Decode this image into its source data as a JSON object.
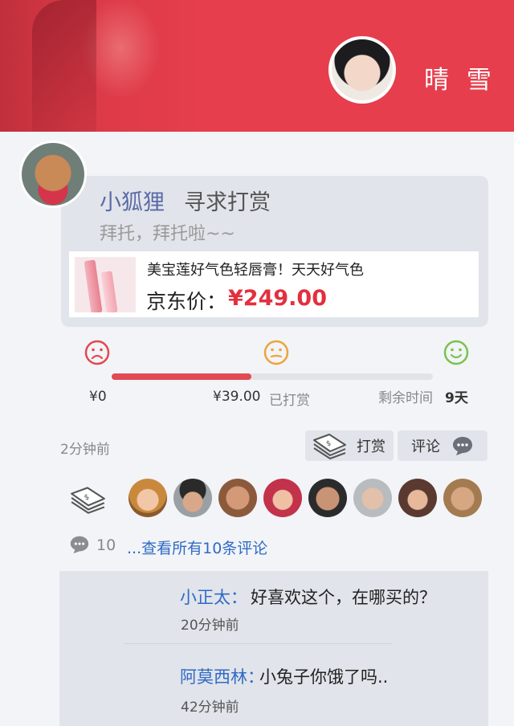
{
  "header": {
    "user_name": "晴 雪"
  },
  "post": {
    "author": "小狐狸",
    "action": "寻求打赏",
    "subtitle": "拜托，拜托啦~~",
    "product": {
      "title": "美宝莲好气色轻唇膏！天天好气色",
      "price_label": "京东价：",
      "price": "¥249.00"
    }
  },
  "progress": {
    "fraction": 0.435,
    "start_label": "¥0",
    "current_amount": "¥39.00",
    "current_label": "已打赏",
    "remaining_label": "剩余时间",
    "remaining_value": "9天",
    "colors": {
      "sad": "#e2484f",
      "neutral": "#eda33c",
      "happy": "#7bc24d",
      "bar": "#e24a54"
    }
  },
  "actions": {
    "time_ago": "2分钟前",
    "tip_label": "打赏",
    "comment_label": "评论"
  },
  "tippers": {
    "avatars": [
      "tipper-1",
      "tipper-2",
      "tipper-3",
      "tipper-4",
      "tipper-5",
      "tipper-6",
      "tipper-7",
      "tipper-8"
    ]
  },
  "comments_summary": {
    "count": "10",
    "see_all": "...查看所有10条评论"
  },
  "comments": [
    {
      "name": "小正太：",
      "text": "好喜欢这个，在哪买的？",
      "time": "20分钟前"
    },
    {
      "name": "阿莫西林：",
      "text": "小兔子你饿了吗..",
      "time": "42分钟前"
    }
  ]
}
